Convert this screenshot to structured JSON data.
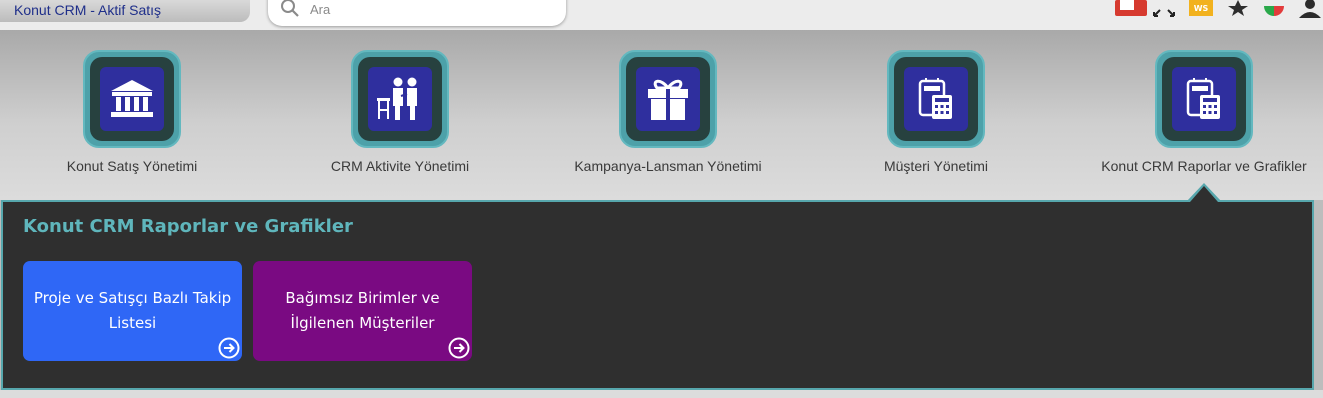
{
  "header": {
    "app_title": "Konut CRM - Aktif Satış",
    "search_placeholder": "Ara"
  },
  "modules": [
    {
      "label": "Konut Satış Yönetimi",
      "icon": "bank-icon"
    },
    {
      "label": "CRM Aktivite Yönetimi",
      "icon": "meeting-icon"
    },
    {
      "label": "Kampanya-Lansman Yönetimi",
      "icon": "gift-icon"
    },
    {
      "label": "Müşteri Yönetimi",
      "icon": "calculator-icon"
    },
    {
      "label": "Konut CRM Raporlar ve Grafikler",
      "icon": "calculator-icon"
    }
  ],
  "panel": {
    "title": "Konut CRM Raporlar ve Grafikler",
    "cards": [
      {
        "label": "Proje ve Satışçı Bazlı Takip Listesi",
        "color": "#2f67f6"
      },
      {
        "label": "Bağımsız Birimler ve İlgilenen Müşteriler",
        "color": "#7a0a82"
      }
    ]
  },
  "colors": {
    "tile_teal": "#4da1a9",
    "tile_core": "#2f2f9e",
    "panel_bg": "#2f2f2f",
    "panel_title": "#5fb6bc",
    "app_title": "#1f2f8a"
  }
}
